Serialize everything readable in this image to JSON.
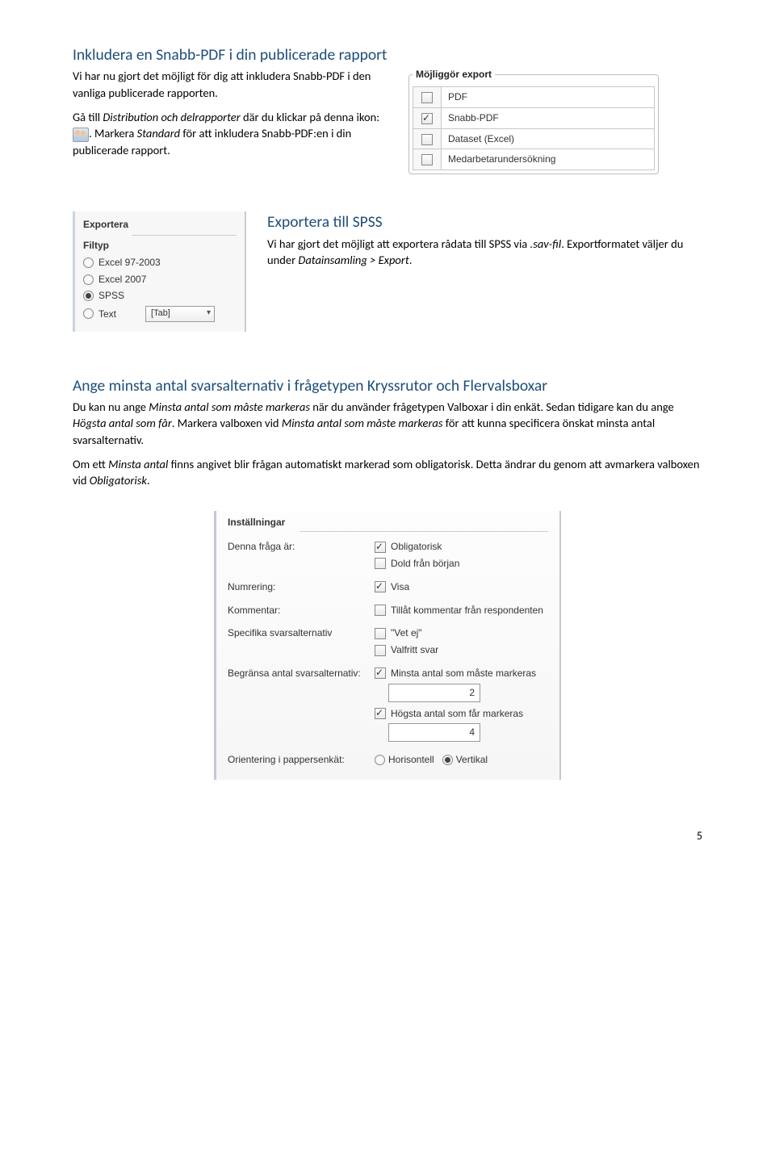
{
  "sec1": {
    "heading": "Inkludera en Snabb-PDF i din publicerade rapport",
    "p1": "Vi har nu gjort det möjligt för dig att inkludera Snabb-PDF i den vanliga publicerade rapporten.",
    "p2a": "Gå till ",
    "p2b": "Distribution och delrapporter",
    "p2c": " där du klickar på denna ikon: ",
    "p2d": ". Markera ",
    "p2e": "Standard",
    "p2f": " för att inkludera Snabb-PDF:en i din publicerade rapport.",
    "export_legend": "Möjliggör export",
    "opts": [
      "PDF",
      "Snabb-PDF",
      "Dataset (Excel)",
      "Medarbetarundersökning"
    ]
  },
  "sec2": {
    "heading": "Exportera till SPSS",
    "p1": "Vi har gjort det möjligt att exportera rådata till SPSS via ",
    "p1b": ".sav-fil",
    "p1c": ". Exportformatet väljer du under ",
    "p1d": "Datainsamling > Export",
    "p1e": ".",
    "panel_head": "Exportera",
    "filetype_label": "Filtyp",
    "options": [
      "Excel 97-2003",
      "Excel 2007",
      "SPSS",
      "Text"
    ],
    "tab_label": "[Tab]"
  },
  "sec3": {
    "heading": "Ange minsta antal svarsalternativ i frågetypen Kryssrutor och Flervalsboxar",
    "p1a": "Du kan nu ange ",
    "p1b": "Minsta antal som måste markeras",
    "p1c": " när du använder frågetypen Valboxar i din enkät. Sedan tidigare kan du ange ",
    "p1d": "Högsta antal som får",
    "p1e": ". Markera valboxen vid ",
    "p1f": "Minsta antal som måste markeras",
    "p1g": " för att kunna specificera önskat minsta antal svarsalternativ.",
    "p2a": "Om ett ",
    "p2b": "Minsta antal",
    "p2c": " finns angivet blir frågan automatiskt markerad som obligatorisk. Detta ändrar du genom att avmarkera valboxen vid ",
    "p2d": "Obligatorisk",
    "p2e": "."
  },
  "settings": {
    "head": "Inställningar",
    "rows": {
      "question": "Denna fråga är:",
      "numbering": "Numrering:",
      "comment": "Kommentar:",
      "specific": "Specifika svarsalternativ",
      "limit": "Begränsa antal svarsalternativ:",
      "orientation": "Orientering i pappersenkät:"
    },
    "opts": {
      "obligatorisk": "Obligatorisk",
      "dold": "Dold från början",
      "visa": "Visa",
      "tillat": "Tillåt kommentar från respondenten",
      "vetej": "\"Vet ej\"",
      "valfritt": "Valfritt svar",
      "minsta": "Minsta antal som måste markeras",
      "minsta_val": "2",
      "hogsta": "Högsta antal som får markeras",
      "hogsta_val": "4",
      "horisontell": "Horisontell",
      "vertikal": "Vertikal"
    }
  },
  "pagenum": "5"
}
